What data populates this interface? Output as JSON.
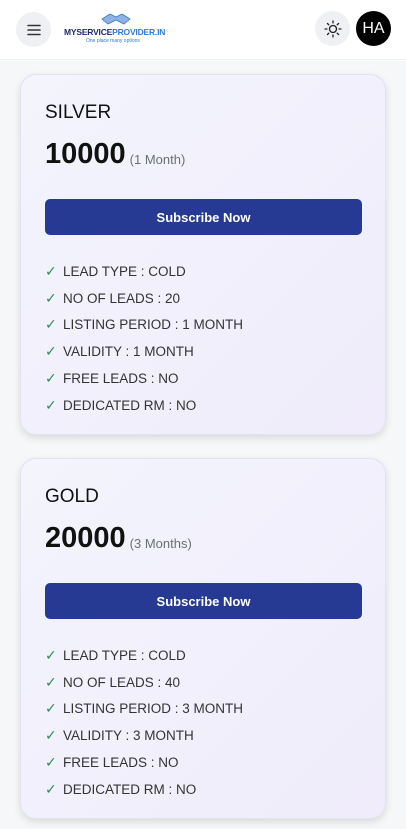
{
  "header": {
    "logo_text_a": "MYSERVICE",
    "logo_text_b": "PROVIDER.IN",
    "logo_tagline": "One place many options",
    "avatar_initials": "HA"
  },
  "plans": [
    {
      "name": "SILVER",
      "price": "10000",
      "duration": "(1 Month)",
      "button_label": "Subscribe Now",
      "features": [
        "LEAD TYPE : COLD",
        "NO OF LEADS : 20",
        "LISTING PERIOD : 1 MONTH",
        "VALIDITY : 1 MONTH",
        "FREE LEADS : NO",
        "DEDICATED RM : NO"
      ]
    },
    {
      "name": "GOLD",
      "price": "20000",
      "duration": "(3 Months)",
      "button_label": "Subscribe Now",
      "features": [
        "LEAD TYPE : COLD",
        "NO OF LEADS : 40",
        "LISTING PERIOD : 3 MONTH",
        "VALIDITY : 3 MONTH",
        "FREE LEADS : NO",
        "DEDICATED RM : NO"
      ]
    }
  ],
  "icons": {
    "menu": "hamburger-menu-icon",
    "theme": "sun-icon",
    "feature": "check-icon"
  },
  "colors": {
    "primary_button": "#263a94",
    "check": "#2e8b57",
    "avatar_bg": "#000000"
  }
}
